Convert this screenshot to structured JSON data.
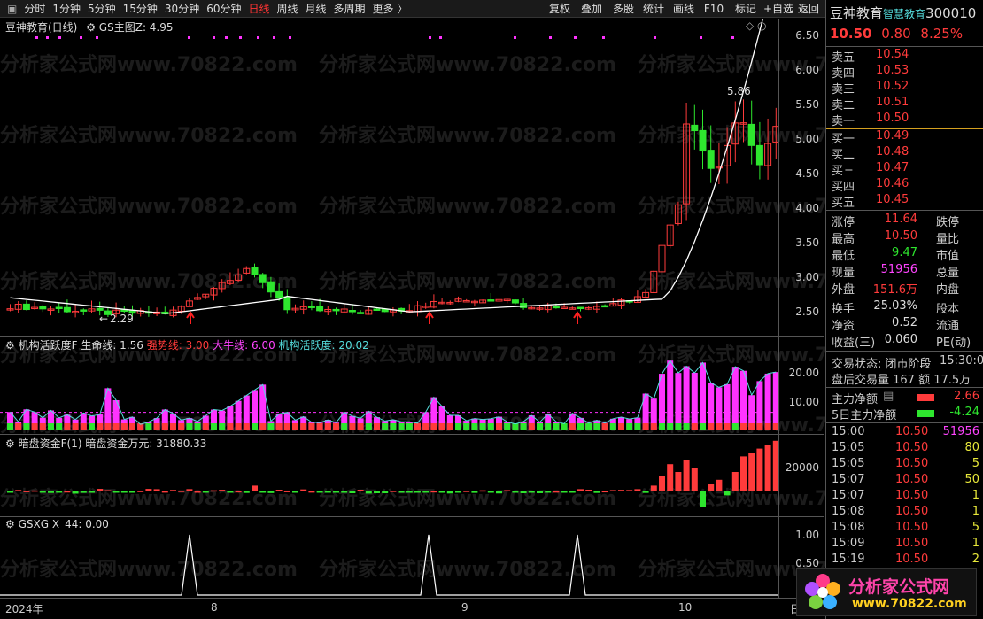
{
  "toolbar": {
    "tabs": [
      "分时",
      "1分钟",
      "5分钟",
      "15分钟",
      "30分钟",
      "60分钟",
      "日线",
      "周线",
      "月线",
      "多周期",
      "更多 〉"
    ],
    "active_tab": "日线",
    "right_buttons": [
      "复权",
      "叠加",
      "多股",
      "统计",
      "画线",
      "F10",
      "标记",
      "+自选",
      "返回"
    ]
  },
  "main_chart": {
    "stock_label": "豆神教育(日线)",
    "indicator_name": "GS主图Z",
    "indicator_value": "4.95",
    "price_ticks": [
      "6.50",
      "6.00",
      "5.50",
      "5.00",
      "4.50",
      "4.00",
      "3.50",
      "3.00",
      "2.50"
    ],
    "annotation_high": "5.86",
    "annotation_low": "2.29"
  },
  "activity_panel": {
    "title": "机构活跃度F",
    "life_label": "生命线: 1.56",
    "strong_label": "强势线: 3.00",
    "bull_label": "大牛线: 6.00",
    "inst_label": "机构活跃度: 20.02",
    "ticks": [
      "20.00",
      "10.00"
    ]
  },
  "dark_funds_panel": {
    "title": "暗盘资金F(1)",
    "value_label": "暗盘资金万元: 31880.33",
    "ticks": [
      "20000"
    ]
  },
  "gsxg_panel": {
    "title": "GSXG",
    "value_label": "X_44: 0.00",
    "ticks": [
      "1.00",
      "0.50"
    ]
  },
  "date_axis": {
    "labels": [
      "2024年",
      "8",
      "9",
      "10",
      "日"
    ]
  },
  "watermark_text": "分析家公式网www.70822.com",
  "quote": {
    "name": "豆神教育",
    "concept": "智慧教育",
    "code": "300010",
    "price": "10.50",
    "change": "0.80",
    "pct": "8.25%",
    "asks": [
      {
        "label": "卖五",
        "price": "10.54"
      },
      {
        "label": "卖四",
        "price": "10.53"
      },
      {
        "label": "卖三",
        "price": "10.52"
      },
      {
        "label": "卖二",
        "price": "10.51"
      },
      {
        "label": "卖一",
        "price": "10.50"
      }
    ],
    "bids": [
      {
        "label": "买一",
        "price": "10.49"
      },
      {
        "label": "买二",
        "price": "10.48"
      },
      {
        "label": "买三",
        "price": "10.47"
      },
      {
        "label": "买四",
        "price": "10.46"
      },
      {
        "label": "买五",
        "price": "10.45"
      }
    ],
    "stats": [
      {
        "label": "涨停",
        "value": "11.64",
        "right": "跌停"
      },
      {
        "label": "最高",
        "value": "10.50",
        "right": "量比"
      },
      {
        "label": "最低",
        "value": "9.47",
        "right": "市值"
      },
      {
        "label": "现量",
        "value": "51956",
        "right": "总量"
      },
      {
        "label": "外盘",
        "value": "151.6万",
        "right": "内盘"
      }
    ],
    "stats2": [
      {
        "label": "换手",
        "value": "25.03%",
        "right": "股本"
      },
      {
        "label": "净资",
        "value": "0.52",
        "right": "流通"
      },
      {
        "label": "收益(三)",
        "value": "0.060",
        "right": "PE(动)"
      }
    ],
    "trade_status": "交易状态: 闭市阶段",
    "trade_time": "15:30:0",
    "after_hours": "盘后交易量 167 额 17.5万",
    "main_net_label": "主力净额",
    "main_net_value": "2.66",
    "main5_label": "5日主力净额",
    "main5_value": "-4.24",
    "ticks": [
      {
        "time": "15:00",
        "price": "10.50",
        "vol": "51956"
      },
      {
        "time": "15:05",
        "price": "10.50",
        "vol": "80"
      },
      {
        "time": "15:05",
        "price": "10.50",
        "vol": "5"
      },
      {
        "time": "15:07",
        "price": "10.50",
        "vol": "50"
      },
      {
        "time": "15:07",
        "price": "10.50",
        "vol": "1"
      },
      {
        "time": "15:08",
        "price": "10.50",
        "vol": "1"
      },
      {
        "time": "15:08",
        "price": "10.50",
        "vol": "5"
      },
      {
        "time": "15:09",
        "price": "10.50",
        "vol": "1"
      },
      {
        "time": "15:19",
        "price": "10.50",
        "vol": "2"
      }
    ]
  },
  "badge": {
    "title": "分析家公式网",
    "url": "www.70822.com"
  },
  "colors": {
    "up": "#ff3b3b",
    "down": "#2ee62e",
    "magenta": "#ff33ff",
    "line": "#ffffff"
  }
}
